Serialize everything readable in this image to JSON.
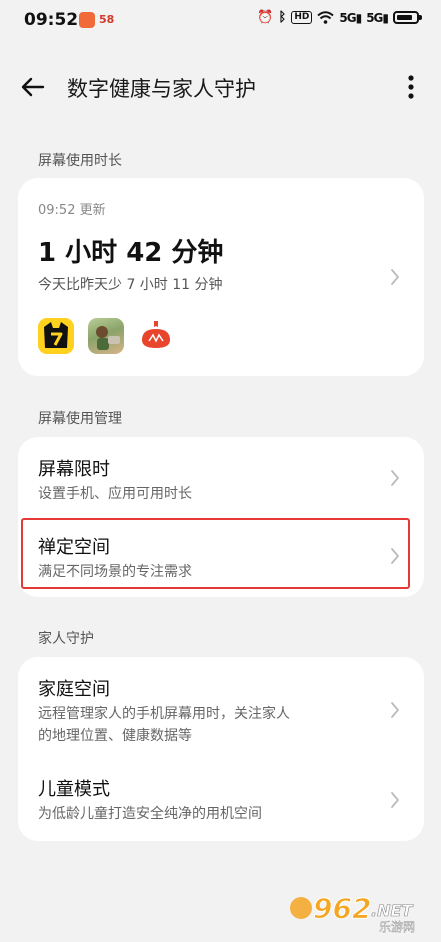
{
  "status_bar": {
    "time": "09:52",
    "app2": "58",
    "hd": "HD",
    "sig1": "5G",
    "sig2": "5G"
  },
  "header": {
    "title": "数字健康与家人守护"
  },
  "sections": {
    "screen_time_label": "屏幕使用时长",
    "screen_mgmt_label": "屏幕使用管理",
    "family_label": "家人守护"
  },
  "screen_time": {
    "updated": "09:52 更新",
    "usage": "1 小时 42 分钟",
    "compare": "今天比昨天少 7 小时 11 分钟",
    "apps": [
      "novel-app-icon",
      "game-app-icon",
      "tomato-app-icon"
    ]
  },
  "management": [
    {
      "title": "屏幕限时",
      "subtitle": "设置手机、应用可用时长"
    },
    {
      "title": "禅定空间",
      "subtitle": "满足不同场景的专注需求"
    }
  ],
  "family": [
    {
      "title": "家庭空间",
      "subtitle_line1": "远程管理家人的手机屏幕用时，关注家人",
      "subtitle_line2": "的地理位置、健康数据等"
    },
    {
      "title": "儿童模式",
      "subtitle": "为低龄儿童打造安全纯净的用机空间"
    }
  ],
  "watermark": {
    "brand": "962",
    "net": ".NET",
    "cn": "乐游网"
  },
  "colors": {
    "background": "#f2f2f2",
    "card": "#ffffff",
    "highlight": "#e53935"
  },
  "battery_level": 0.85
}
